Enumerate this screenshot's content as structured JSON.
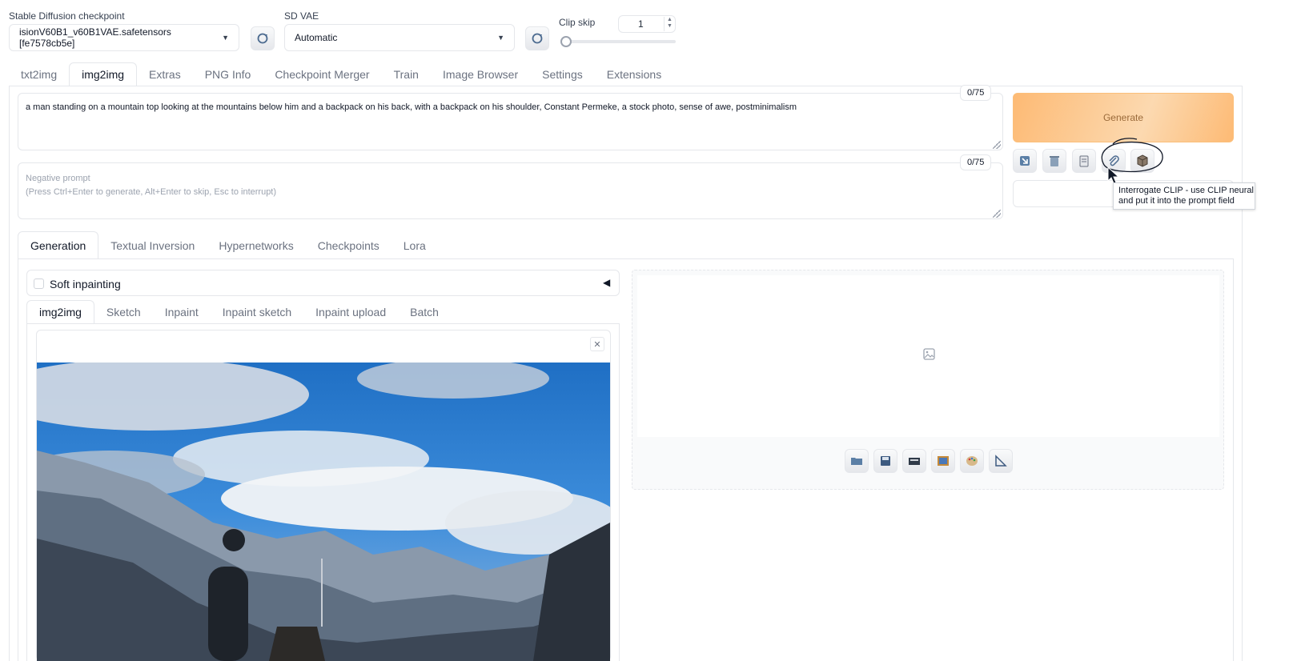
{
  "settings": {
    "checkpoint_label": "Stable Diffusion checkpoint",
    "checkpoint_value": "isionV60B1_v60B1VAE.safetensors [fe7578cb5e]",
    "vae_label": "SD VAE",
    "vae_value": "Automatic",
    "clip_skip_label": "Clip skip",
    "clip_skip_value": "1"
  },
  "main_tabs": [
    {
      "label": "txt2img"
    },
    {
      "label": "img2img"
    },
    {
      "label": "Extras"
    },
    {
      "label": "PNG Info"
    },
    {
      "label": "Checkpoint Merger"
    },
    {
      "label": "Train"
    },
    {
      "label": "Image Browser"
    },
    {
      "label": "Settings"
    },
    {
      "label": "Extensions"
    }
  ],
  "prompt": {
    "text": "a man standing on a mountain top looking at the mountains below him and a backpack on his back, with a backpack on his shoulder, Constant Permeke, a stock photo, sense of awe, postminimalism",
    "token_count": "0/75"
  },
  "negative_prompt": {
    "placeholder_line1": "Negative prompt",
    "placeholder_line2": "(Press Ctrl+Enter to generate, Alt+Enter to skip, Esc to interrupt)",
    "token_count": "0/75"
  },
  "generate_label": "Generate",
  "tooltip": {
    "line1": "Interrogate CLIP - use CLIP neural",
    "line2": "and put it into the prompt field"
  },
  "sub_tabs": [
    {
      "label": "Generation"
    },
    {
      "label": "Textual Inversion"
    },
    {
      "label": "Hypernetworks"
    },
    {
      "label": "Checkpoints"
    },
    {
      "label": "Lora"
    }
  ],
  "soft_inpainting_label": "Soft inpainting",
  "img_tabs": [
    {
      "label": "img2img"
    },
    {
      "label": "Sketch"
    },
    {
      "label": "Inpaint"
    },
    {
      "label": "Inpaint sketch"
    },
    {
      "label": "Inpaint upload"
    },
    {
      "label": "Batch"
    }
  ],
  "colors": {
    "generate": "#fdba74",
    "tooltip_border": "#d1d5db"
  }
}
